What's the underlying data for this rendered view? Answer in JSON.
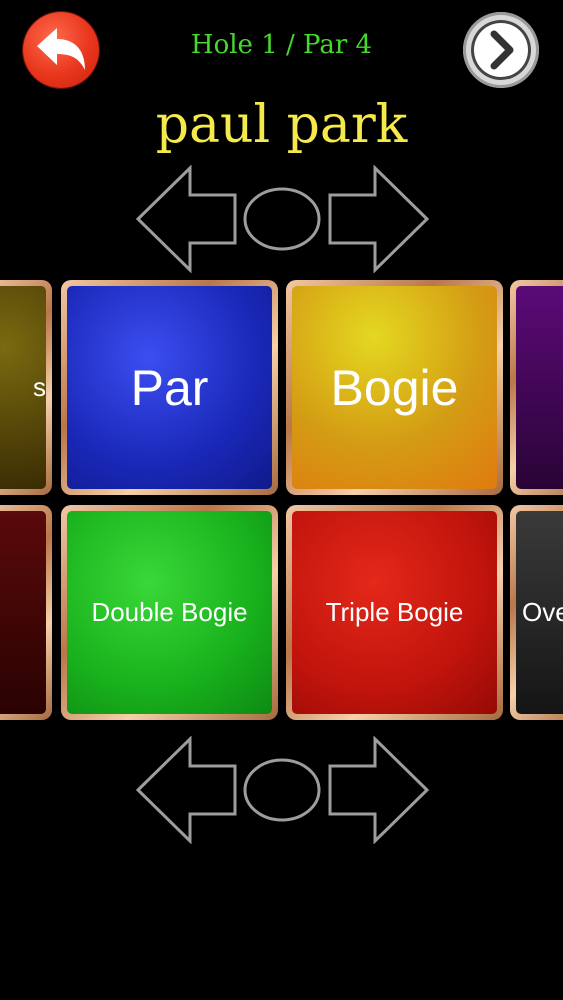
{
  "header": {
    "hole_label": "Hole 1 / Par 4",
    "player_name": "paul park"
  },
  "icons": {
    "back": "back-arrow-icon",
    "next": "chevron-right-icon"
  },
  "tiles": {
    "row1": [
      {
        "label": "s",
        "color": "#5a4a08"
      },
      {
        "label": "Par",
        "color": "#1f2fcf"
      },
      {
        "label": "Bogie",
        "color": "#d8b010"
      },
      {
        "label": "",
        "color": "#4a0a5c"
      }
    ],
    "row2": [
      {
        "label": "",
        "color": "#4a0808"
      },
      {
        "label": "Double Bogie",
        "color": "#1cb520"
      },
      {
        "label": "Triple Bogie",
        "color": "#c81a10"
      },
      {
        "label": "Ove",
        "color": "#2a2a2a"
      }
    ]
  }
}
